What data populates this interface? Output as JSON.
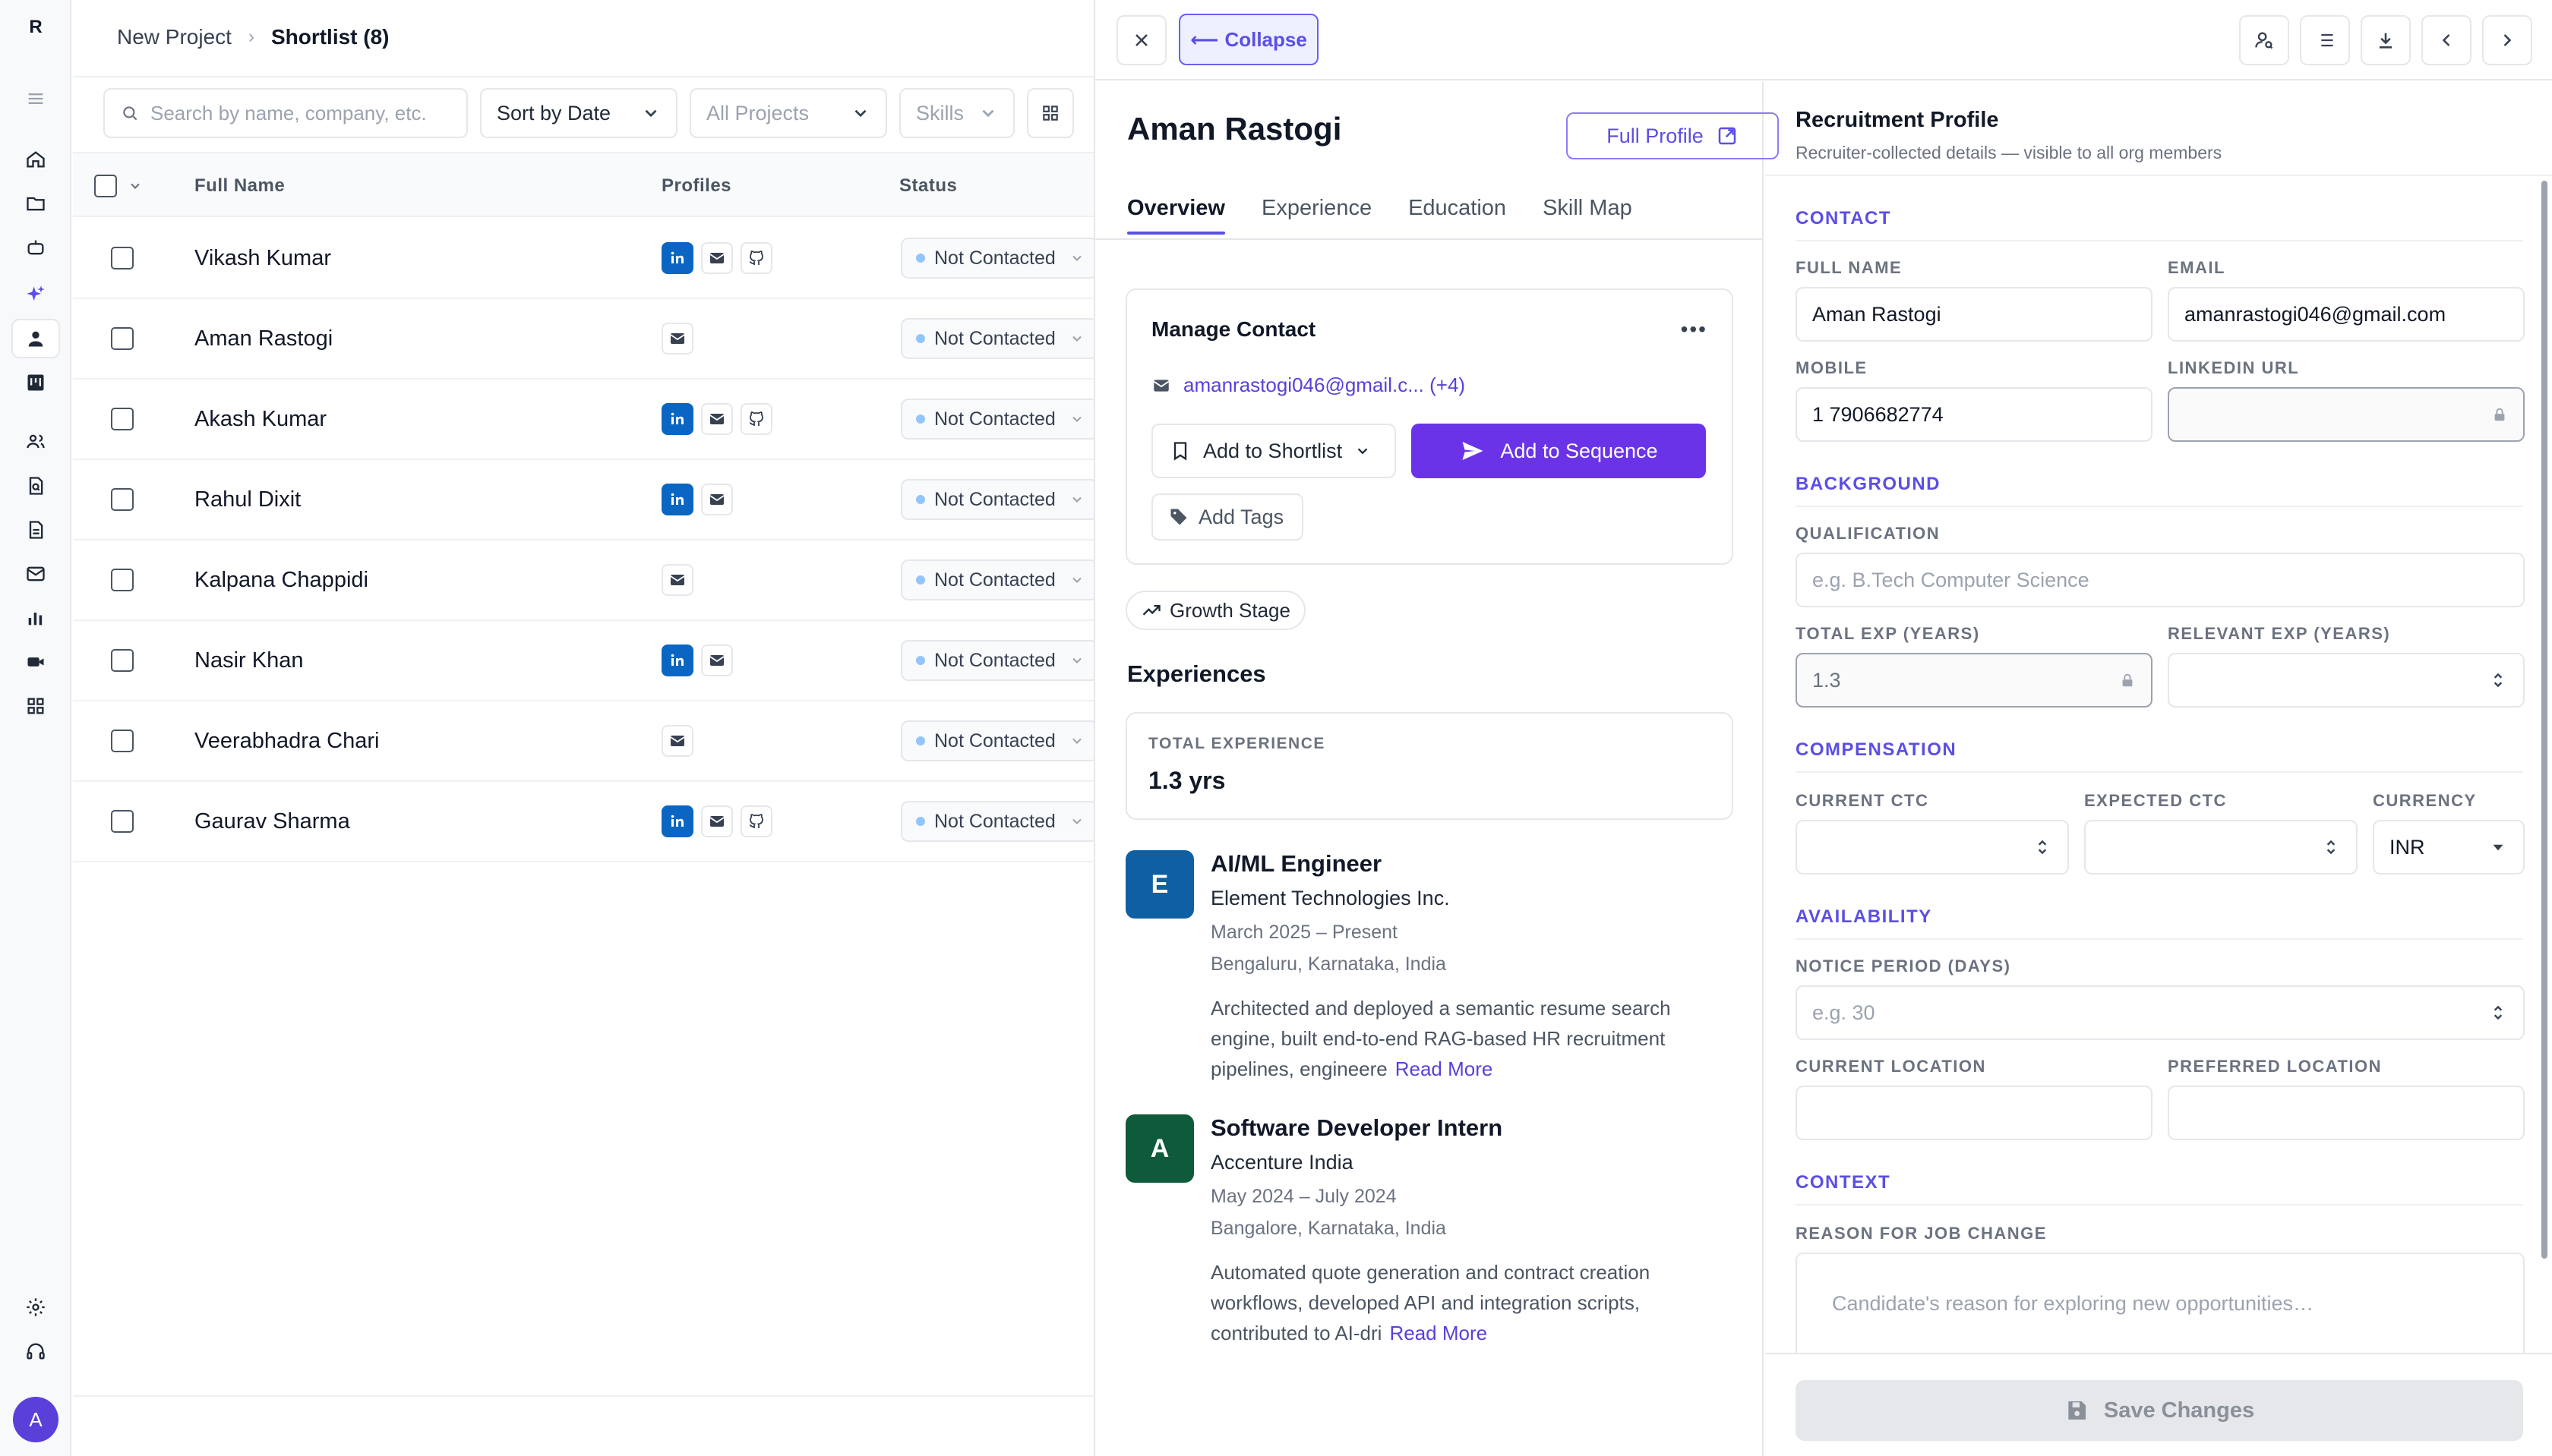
{
  "rail": {
    "logo": "R",
    "avatar_initial": "A"
  },
  "breadcrumb": {
    "project": "New Project",
    "current": "Shortlist (8)"
  },
  "filters": {
    "search_placeholder": "Search by name, company, etc.",
    "sort": "Sort by Date",
    "projects": "All Projects",
    "skills": "Skills"
  },
  "table": {
    "headers": {
      "name": "Full Name",
      "profiles": "Profiles",
      "status": "Status"
    },
    "rows": [
      {
        "name": "Vikash Kumar",
        "linkedin": true,
        "email": true,
        "github": true,
        "status": "Not Contacted"
      },
      {
        "name": "Aman Rastogi",
        "linkedin": false,
        "email": true,
        "github": false,
        "status": "Not Contacted"
      },
      {
        "name": "Akash Kumar",
        "linkedin": true,
        "email": true,
        "github": true,
        "status": "Not Contacted"
      },
      {
        "name": "Rahul Dixit",
        "linkedin": true,
        "email": true,
        "github": false,
        "status": "Not Contacted"
      },
      {
        "name": "Kalpana Chappidi",
        "linkedin": false,
        "email": true,
        "github": false,
        "status": "Not Contacted"
      },
      {
        "name": "Nasir Khan",
        "linkedin": true,
        "email": true,
        "github": false,
        "status": "Not Contacted"
      },
      {
        "name": "Veerabhadra Chari",
        "linkedin": false,
        "email": true,
        "github": false,
        "status": "Not Contacted"
      },
      {
        "name": "Gaurav Sharma",
        "linkedin": true,
        "email": true,
        "github": true,
        "status": "Not Contacted"
      }
    ]
  },
  "drawer": {
    "collapse_label": "Collapse",
    "candidate_name": "Aman Rastogi",
    "full_profile_label": "Full Profile",
    "tabs": [
      "Overview",
      "Experience",
      "Education",
      "Skill Map"
    ],
    "active_tab": "Overview",
    "manage_contact": {
      "title": "Manage Contact",
      "email": "amanrastogi046@gmail.c... (+4)",
      "shortlist_label": "Add to Shortlist",
      "sequence_label": "Add to Sequence",
      "tags_label": "Add Tags"
    },
    "growth_stage_label": "Growth Stage",
    "experiences_heading": "Experiences",
    "total_experience": {
      "label": "TOTAL EXPERIENCE",
      "value": "1.3 yrs"
    },
    "experiences": [
      {
        "logo": "E",
        "logo_color": "#0f5fa3",
        "title": "AI/ML Engineer",
        "company": "Element Technologies Inc.",
        "dates": "March 2025 – Present",
        "location": "Bengaluru, Karnataka, India",
        "description": "Architected and deployed a semantic resume search engine, built end-to-end RAG-based HR recruitment pipelines, engineere",
        "read_more": "Read More"
      },
      {
        "logo": "A",
        "logo_color": "#0f5a3a",
        "title": "Software Developer Intern",
        "company": "Accenture India",
        "dates": "May 2024 – July 2024",
        "location": "Bangalore, Karnataka, India",
        "description": "Automated quote generation and contract creation workflows, developed API and integration scripts, contributed to AI-dri",
        "read_more": "Read More"
      }
    ]
  },
  "recruitment_profile": {
    "title": "Recruitment Profile",
    "subtitle": "Recruiter-collected details — visible to all org members",
    "sections": {
      "contact": "CONTACT",
      "background": "BACKGROUND",
      "compensation": "COMPENSATION",
      "availability": "AVAILABILITY",
      "context": "CONTEXT"
    },
    "fields": {
      "full_name": {
        "label": "FULL NAME",
        "value": "Aman Rastogi"
      },
      "email": {
        "label": "EMAIL",
        "value": "amanrastogi046@gmail.com"
      },
      "mobile": {
        "label": "MOBILE",
        "value": "1 7906682774"
      },
      "linkedin": {
        "label": "LINKEDIN URL",
        "value": ""
      },
      "qualification": {
        "label": "QUALIFICATION",
        "placeholder": "e.g. B.Tech Computer Science"
      },
      "total_exp": {
        "label": "TOTAL EXP (YEARS)",
        "value": "1.3"
      },
      "relevant_exp": {
        "label": "RELEVANT EXP (YEARS)",
        "value": ""
      },
      "current_ctc": {
        "label": "CURRENT CTC",
        "value": ""
      },
      "expected_ctc": {
        "label": "EXPECTED CTC",
        "value": ""
      },
      "currency": {
        "label": "CURRENCY",
        "value": "INR"
      },
      "notice_period": {
        "label": "NOTICE PERIOD (DAYS)",
        "placeholder": "e.g. 30"
      },
      "current_location": {
        "label": "CURRENT LOCATION",
        "value": ""
      },
      "preferred_location": {
        "label": "PREFERRED LOCATION",
        "value": ""
      },
      "reason": {
        "label": "REASON FOR JOB CHANGE",
        "placeholder": "Candidate's reason for exploring new opportunities…"
      }
    },
    "save_label": "Save Changes"
  },
  "colors": {
    "accent": "#5b4ee6",
    "primary_button": "#6a33e8",
    "linkedin": "#0a66c2"
  }
}
